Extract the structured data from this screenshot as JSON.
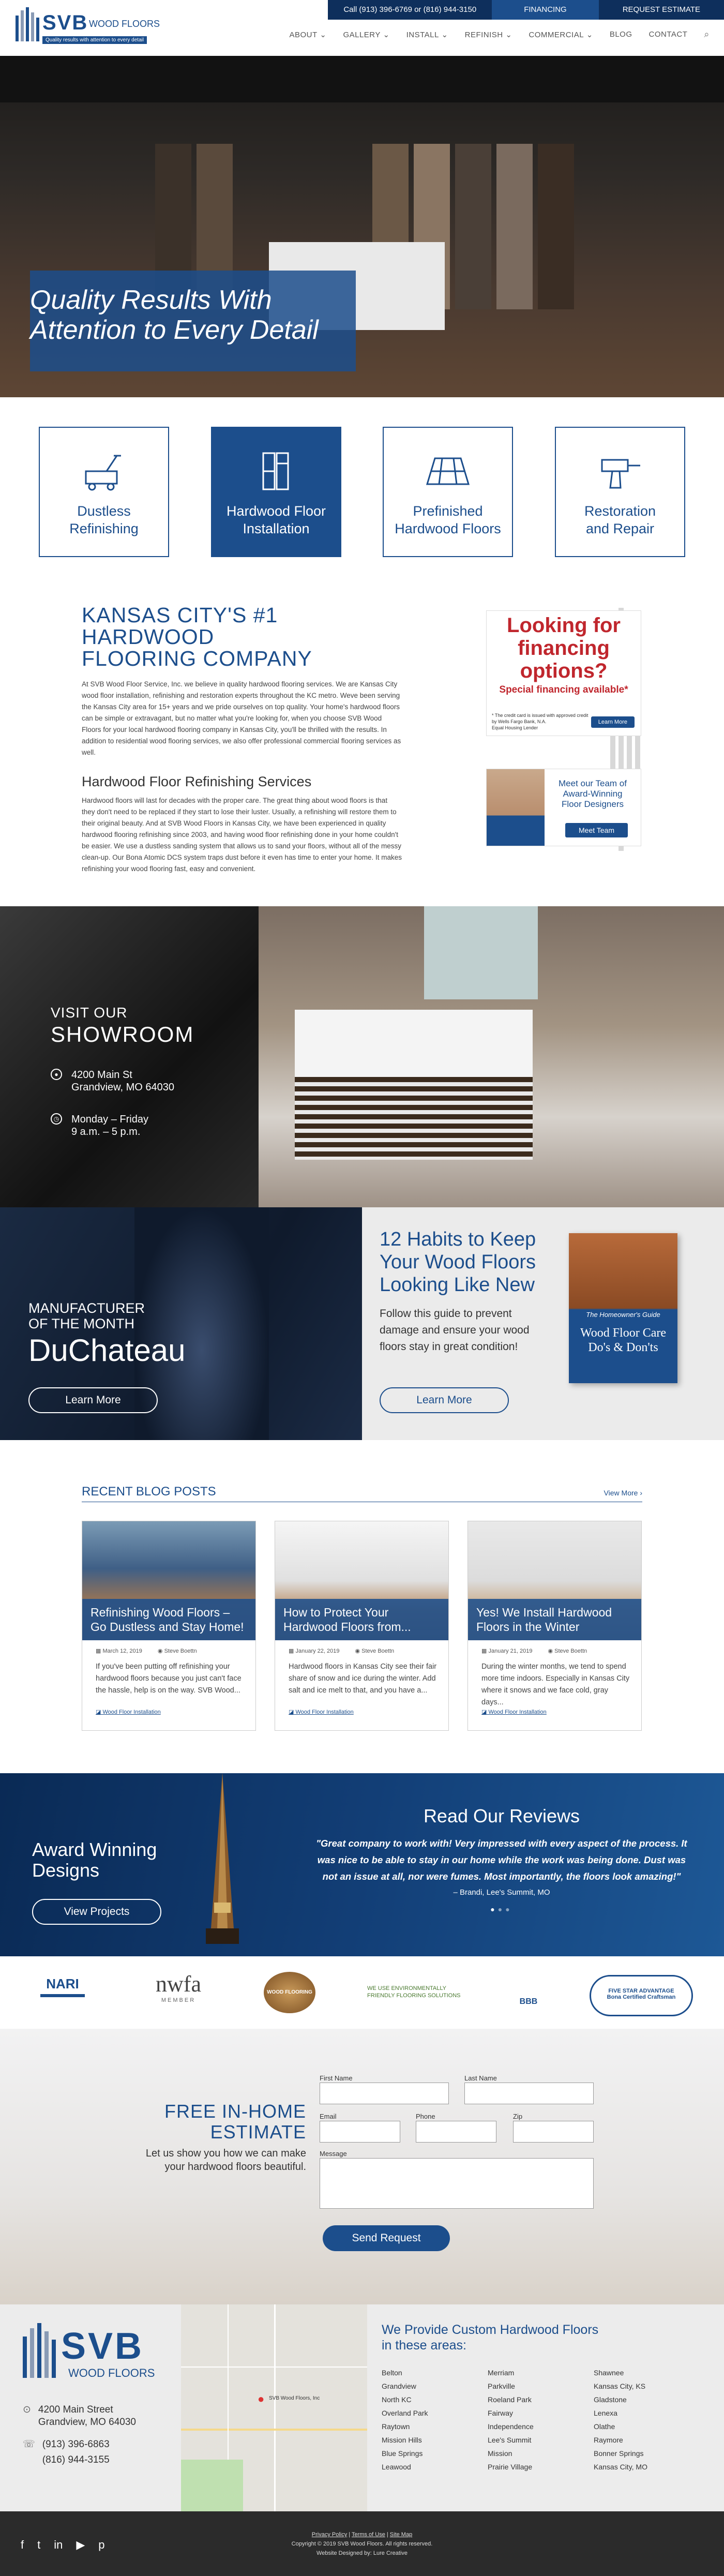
{
  "header": {
    "logo_main": "SVB",
    "logo_sub": "WOOD FLOORS",
    "logo_tagline": "Quality results with attention to every detail",
    "phone": "Call (913) 396-6769 or (816) 944-3150",
    "financing": "FINANCING",
    "request": "REQUEST ESTIMATE",
    "nav": [
      "ABOUT",
      "GALLERY",
      "INSTALL",
      "REFINISH",
      "COMMERCIAL",
      "BLOG",
      "CONTACT"
    ],
    "colors": {
      "navy": "#1c4e8c",
      "dark_navy": "#0e2f5c"
    }
  },
  "hero": {
    "line1": "Quality Results With",
    "line2": "Attention to Every Detail"
  },
  "services": [
    {
      "l1": "Dustless",
      "l2": "Refinishing",
      "icon": "sander-icon"
    },
    {
      "l1": "Hardwood Floor",
      "l2": "Installation",
      "icon": "planks-icon"
    },
    {
      "l1": "Prefinished",
      "l2": "Hardwood Floors",
      "icon": "floorboards-icon"
    },
    {
      "l1": "Restoration",
      "l2": "and Repair",
      "icon": "drill-icon"
    }
  ],
  "intro": {
    "title1": "KANSAS CITY'S #1 HARDWOOD",
    "title2": "FLOORING COMPANY",
    "p1": "At SVB Wood Floor Service, Inc. we believe in quality hardwood flooring services. We are Kansas City wood floor installation, refinishing and restoration experts throughout the KC metro. Weve been serving the Kansas City area for 15+ years and we pride ourselves on top quality. Your home's hardwood floors can be simple or extravagant, but no matter what you're looking for, when you choose SVB Wood Floors for your local hardwood flooring company in Kansas City, you'll be thrilled with the results. In addition to residential wood flooring services, we also offer professional commercial flooring services as well.",
    "subtitle": "Hardwood Floor Refinishing Services",
    "p2": "Hardwood floors will last for decades with the proper care. The great thing about wood floors is that they don't need to be replaced if they start to lose their luster. Usually, a refinishing will restore them to their original beauty. And at SVB Wood Floors in Kansas City, we have been experienced in quality hardwood flooring refinishing since 2003, and having wood floor refinishing done in your home couldn't be easier. We use a dustless sanding system that allows us to sand your floors, without all of the messy clean-up. Our Bona Atomic DCS system traps dust before it even has time to enter your home. It makes refinishing your wood flooring fast, easy and convenient."
  },
  "finance": {
    "l1": "Looking for",
    "l2": "financing",
    "l3": "options?",
    "sub": "Special financing available*",
    "fine1": "* The credit card is issued with approved credit",
    "fine2": "by Wells Fargo Bank, N.A.",
    "fine3": "Equal Housing Lender",
    "btn": "Learn More"
  },
  "team": {
    "l1": "Meet our Team of",
    "l2": "Award-Winning",
    "l3": "Floor Designers",
    "btn": "Meet Team"
  },
  "showroom": {
    "visit": "VISIT OUR",
    "title": "SHOWROOM",
    "addr1": "4200 Main St",
    "addr2": "Grandview, MO 64030",
    "hours1": "Monday – Friday",
    "hours2": "9 a.m. – 5 p.m."
  },
  "mfr": {
    "l1": "MANUFACTURER",
    "l2": "OF THE MONTH",
    "name": "DuChateau",
    "btn": "Learn More"
  },
  "guide": {
    "t1": "12 Habits to Keep",
    "t2": "Your Wood Floors",
    "t3": "Looking Like New",
    "d1": "Follow this guide to prevent",
    "d2": "damage and ensure your wood",
    "d3": "floors stay in great condition!",
    "btn": "Learn More",
    "book_top": "The Homeowner's Guide",
    "book_t1": "Wood Floor Care",
    "book_t2": "Do's & Don'ts"
  },
  "blog": {
    "heading": "RECENT BLOG POSTS",
    "view": "View More",
    "posts": [
      {
        "title": "Refinishing Wood Floors – Go Dustless and Stay Home!",
        "date": "March 12, 2019",
        "author": "Steve Boettn",
        "excerpt": "If you've been putting off refinishing your hardwood floors because you just can't face the hassle, help is on the way. SVB Wood...",
        "tag": "Wood Floor Installation"
      },
      {
        "title": "How to Protect Your Hardwood Floors from...",
        "date": "January 22, 2019",
        "author": "Steve Boettn",
        "excerpt": "Hardwood floors in Kansas City see their fair share of snow and ice during the winter. Add salt and ice melt to that, and you have a...",
        "tag": "Wood Floor Installation"
      },
      {
        "title": "Yes! We Install Hardwood Floors in the Winter",
        "date": "January 21, 2019",
        "author": "Steve Boettn",
        "excerpt": "During the winter months, we tend to spend more time indoors. Especially in Kansas City where it snows and we face cold, gray days...",
        "tag": "Wood Floor Installation"
      }
    ]
  },
  "reviews": {
    "award1": "Award Winning",
    "award2": "Designs",
    "btn": "View Projects",
    "heading": "Read Our Reviews",
    "q1": "\"Great company to work with! Very impressed with every aspect of the process. It",
    "q2": "was nice to be able to stay in our home while the work was being done. Dust was",
    "q3": "not an issue at all, nor were fumes. Most importantly, the floors look amazing!\"",
    "author": "– Brandi, Lee's Summit, MO"
  },
  "logos": {
    "nari": "NARI",
    "nwfa": "nwfa",
    "nwfa_sub": "MEMBER",
    "wood": "WOOD FLOORING",
    "env1": "WE USE ENVIRONMENTALLY",
    "env2": "FRIENDLY FLOORING SOLUTIONS",
    "bbb": "BBB",
    "bona1": "FIVE STAR ADVANTAGE",
    "bona2": "Bona Certified Craftsman"
  },
  "estimate": {
    "t1": "FREE IN-HOME",
    "t2": "ESTIMATE",
    "d1": "Let us show you how we can make",
    "d2": "your hardwood floors beautiful.",
    "first": "First Name",
    "last": "Last Name",
    "email": "Email",
    "phone": "Phone",
    "zip": "Zip",
    "message": "Message",
    "btn": "Send Request"
  },
  "footer": {
    "addr1": "4200 Main Street",
    "addr2": "Grandview, MO 64030",
    "ph1": "(913) 396-6863",
    "ph2": "(816) 944-3155",
    "areas_t1": "We Provide Custom Hardwood Floors",
    "areas_t2": "in these areas:",
    "cities": [
      "Belton",
      "Grandview",
      "North KC",
      "Overland Park",
      "Raytown",
      "Mission Hills",
      "Blue Springs",
      "Leawood",
      "Merriam",
      "Parkville",
      "Roeland Park",
      "Fairway",
      "Independence",
      "Lee's Summit",
      "Mission",
      "Prairie Village",
      "Shawnee",
      "Kansas City, KS",
      "Gladstone",
      "Lenexa",
      "Olathe",
      "Raymore",
      "Bonner Springs",
      "Kansas City, MO"
    ],
    "map_label": "SVB Wood Floors, Inc",
    "links": [
      "Privacy Policy",
      "Terms of Use",
      "Site Map"
    ],
    "copy": "Copyright © 2019 SVB Wood Floors. All rights reserved.",
    "credit": "Website Designed by: Lure Creative"
  }
}
